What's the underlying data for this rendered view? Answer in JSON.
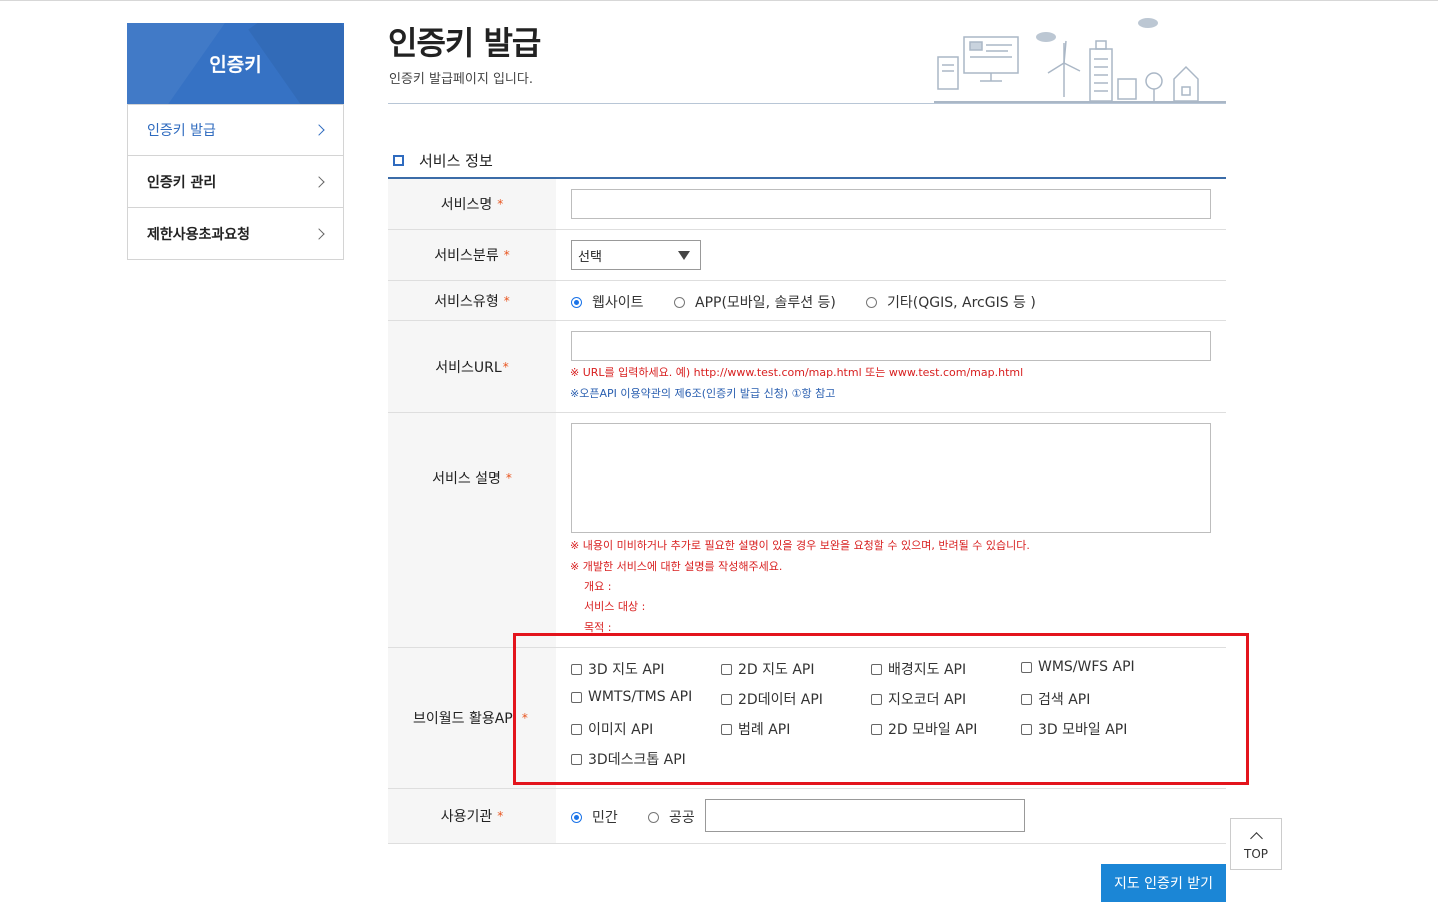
{
  "sidebar": {
    "title": "인증키",
    "items": [
      {
        "label": "인증키 발급"
      },
      {
        "label": "인증키 관리"
      },
      {
        "label": "제한사용초과요청"
      }
    ]
  },
  "header": {
    "title": "인증키 발급",
    "subtitle": "인증키 발급페이지 입니다."
  },
  "section": {
    "title": "서비스 정보"
  },
  "form": {
    "required_mark": "*",
    "service_name": {
      "label": "서비스명",
      "value": ""
    },
    "service_category": {
      "label": "서비스분류",
      "selected": "선택"
    },
    "service_type": {
      "label": "서비스유형",
      "options": [
        {
          "label": "웹사이트",
          "checked": true
        },
        {
          "label": "APP(모바일, 솔루션 등)",
          "checked": false
        },
        {
          "label": "기타(QGIS, ArcGIS 등 )",
          "checked": false
        }
      ]
    },
    "service_url": {
      "label": "서비스URL",
      "value": "",
      "note_red": "※ URL를 입력하세요. 예) http://www.test.com/map.html 또는 www.test.com/map.html",
      "note_blue": "※오픈API 이용약관의 제6조(인증키 발급 신청) ①항 참고"
    },
    "service_desc": {
      "label": "서비스 설명",
      "value": "",
      "notes": [
        "※ 내용이 미비하거나 추가로 필요한 설명이 있을 경우 보완을 요청할 수 있으며, 반려될 수 있습니다.",
        "※ 개발한 서비스에 대한 설명를 작성해주세요."
      ],
      "sub_notes": [
        "개요 :",
        "서비스 대상 :",
        "목적 :"
      ]
    },
    "vworld_api": {
      "label": "브이월드 활용API",
      "options": [
        "3D 지도 API",
        "2D 지도 API",
        "배경지도 API",
        "WMS/WFS API",
        "WMTS/TMS API",
        "2D데이터 API",
        "지오코더 API",
        "검색 API",
        "이미지 API",
        "범례 API",
        "2D 모바일 API",
        "3D 모바일 API",
        "3D데스크톱 API"
      ]
    },
    "org": {
      "label": "사용기관",
      "options": [
        {
          "label": "민간",
          "checked": true
        },
        {
          "label": "공공",
          "checked": false
        }
      ],
      "value": ""
    }
  },
  "buttons": {
    "submit": "지도 인증키 받기",
    "top": "TOP"
  },
  "colors": {
    "accent": "#3672c4",
    "submit": "#1b86d6",
    "highlight": "#e3141c",
    "required": "#e8541e"
  }
}
